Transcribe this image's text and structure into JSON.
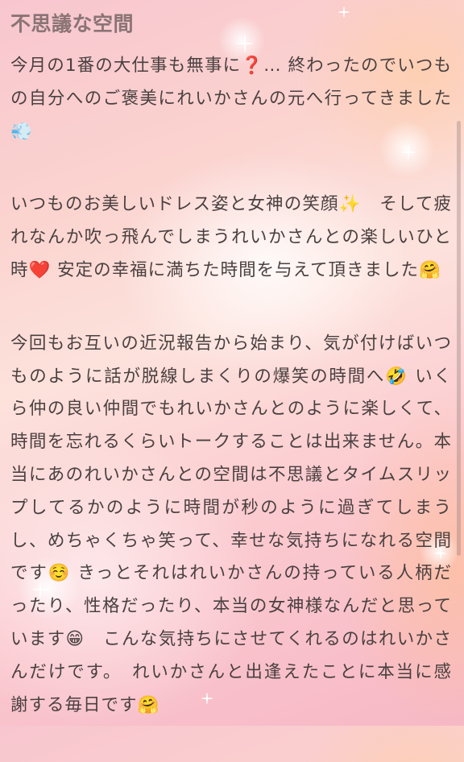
{
  "article": {
    "title": "不思議な空間",
    "paragraphs": [
      "今月の1番の大仕事も無事に❓… 終わったのでいつもの自分へのご褒美にれいかさんの元へ行ってきました💨",
      "いつものお美しいドレス姿と女神の笑顔✨　そして疲れなんか吹っ飛んでしまうれいかさんとの楽しいひと時❤️ 安定の幸福に満ちた時間を与えて頂きました🤗",
      "今回もお互いの近況報告から始まり、気が付けばいつものように話が脱線しまくりの爆笑の時間へ🤣 いくら仲の良い仲間でもれいかさんとのように楽しくて、時間を忘れるくらいトークすることは出来ません。本当にあのれいかさんとの空間は不思議とタイムスリップしてるかのように時間が秒のように過ぎてしまうし、めちゃくちゃ笑って、幸せな気持ちになれる空間です☺️ きっとそれはれいかさんの持っている人柄だったり、性格だったり、本当の女神様なんだと思っています😁　こんな気持ちにさせてくれるのはれいかさんだけです。　れいかさんと出逢えたことに本当に感謝する毎日です🤗"
    ]
  },
  "colors": {
    "title": "#8a7474",
    "body_text": "#4a4040",
    "background_pink": "#f8c6cf",
    "background_peach": "#fde2dc"
  }
}
